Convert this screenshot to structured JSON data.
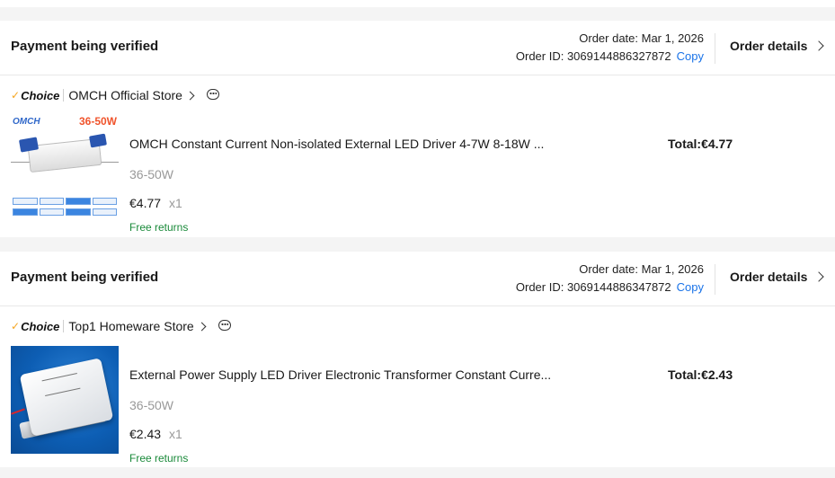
{
  "orders": [
    {
      "status": "Payment being verified",
      "order_date": "Order date: Mar 1, 2026",
      "order_id": "Order ID: 3069144886327872",
      "copy_label": "Copy",
      "details_label": "Order details",
      "choice_label": "Choice",
      "store_name": "OMCH Official Store",
      "product": {
        "title": "OMCH Constant Current Non-isolated External LED Driver 4-7W 8-18W ...",
        "variant": "36-50W",
        "price": "€4.77",
        "quantity": "x1",
        "returns": "Free returns",
        "thumb_brand": "OMCH",
        "thumb_watt": "36-50W"
      },
      "total": "Total:€4.77"
    },
    {
      "status": "Payment being verified",
      "order_date": "Order date: Mar 1, 2026",
      "order_id": "Order ID: 3069144886347872",
      "copy_label": "Copy",
      "details_label": "Order details",
      "choice_label": "Choice",
      "store_name": "Top1 Homeware Store",
      "product": {
        "title": "External Power Supply LED Driver Electronic Transformer Constant Curre...",
        "variant": "36-50W",
        "price": "€2.43",
        "quantity": "x1",
        "returns": "Free returns"
      },
      "total": "Total:€2.43"
    }
  ],
  "icons": {
    "details_chevron": "chevron-right-icon",
    "store_chevron": "chevron-right-icon",
    "chat": "chat-bubble-icon",
    "choice_check": "check-icon"
  },
  "colors": {
    "link": "#1a73e8",
    "free_returns": "#1a8a3a",
    "choice_check": "#f5a623",
    "muted": "#999999"
  }
}
